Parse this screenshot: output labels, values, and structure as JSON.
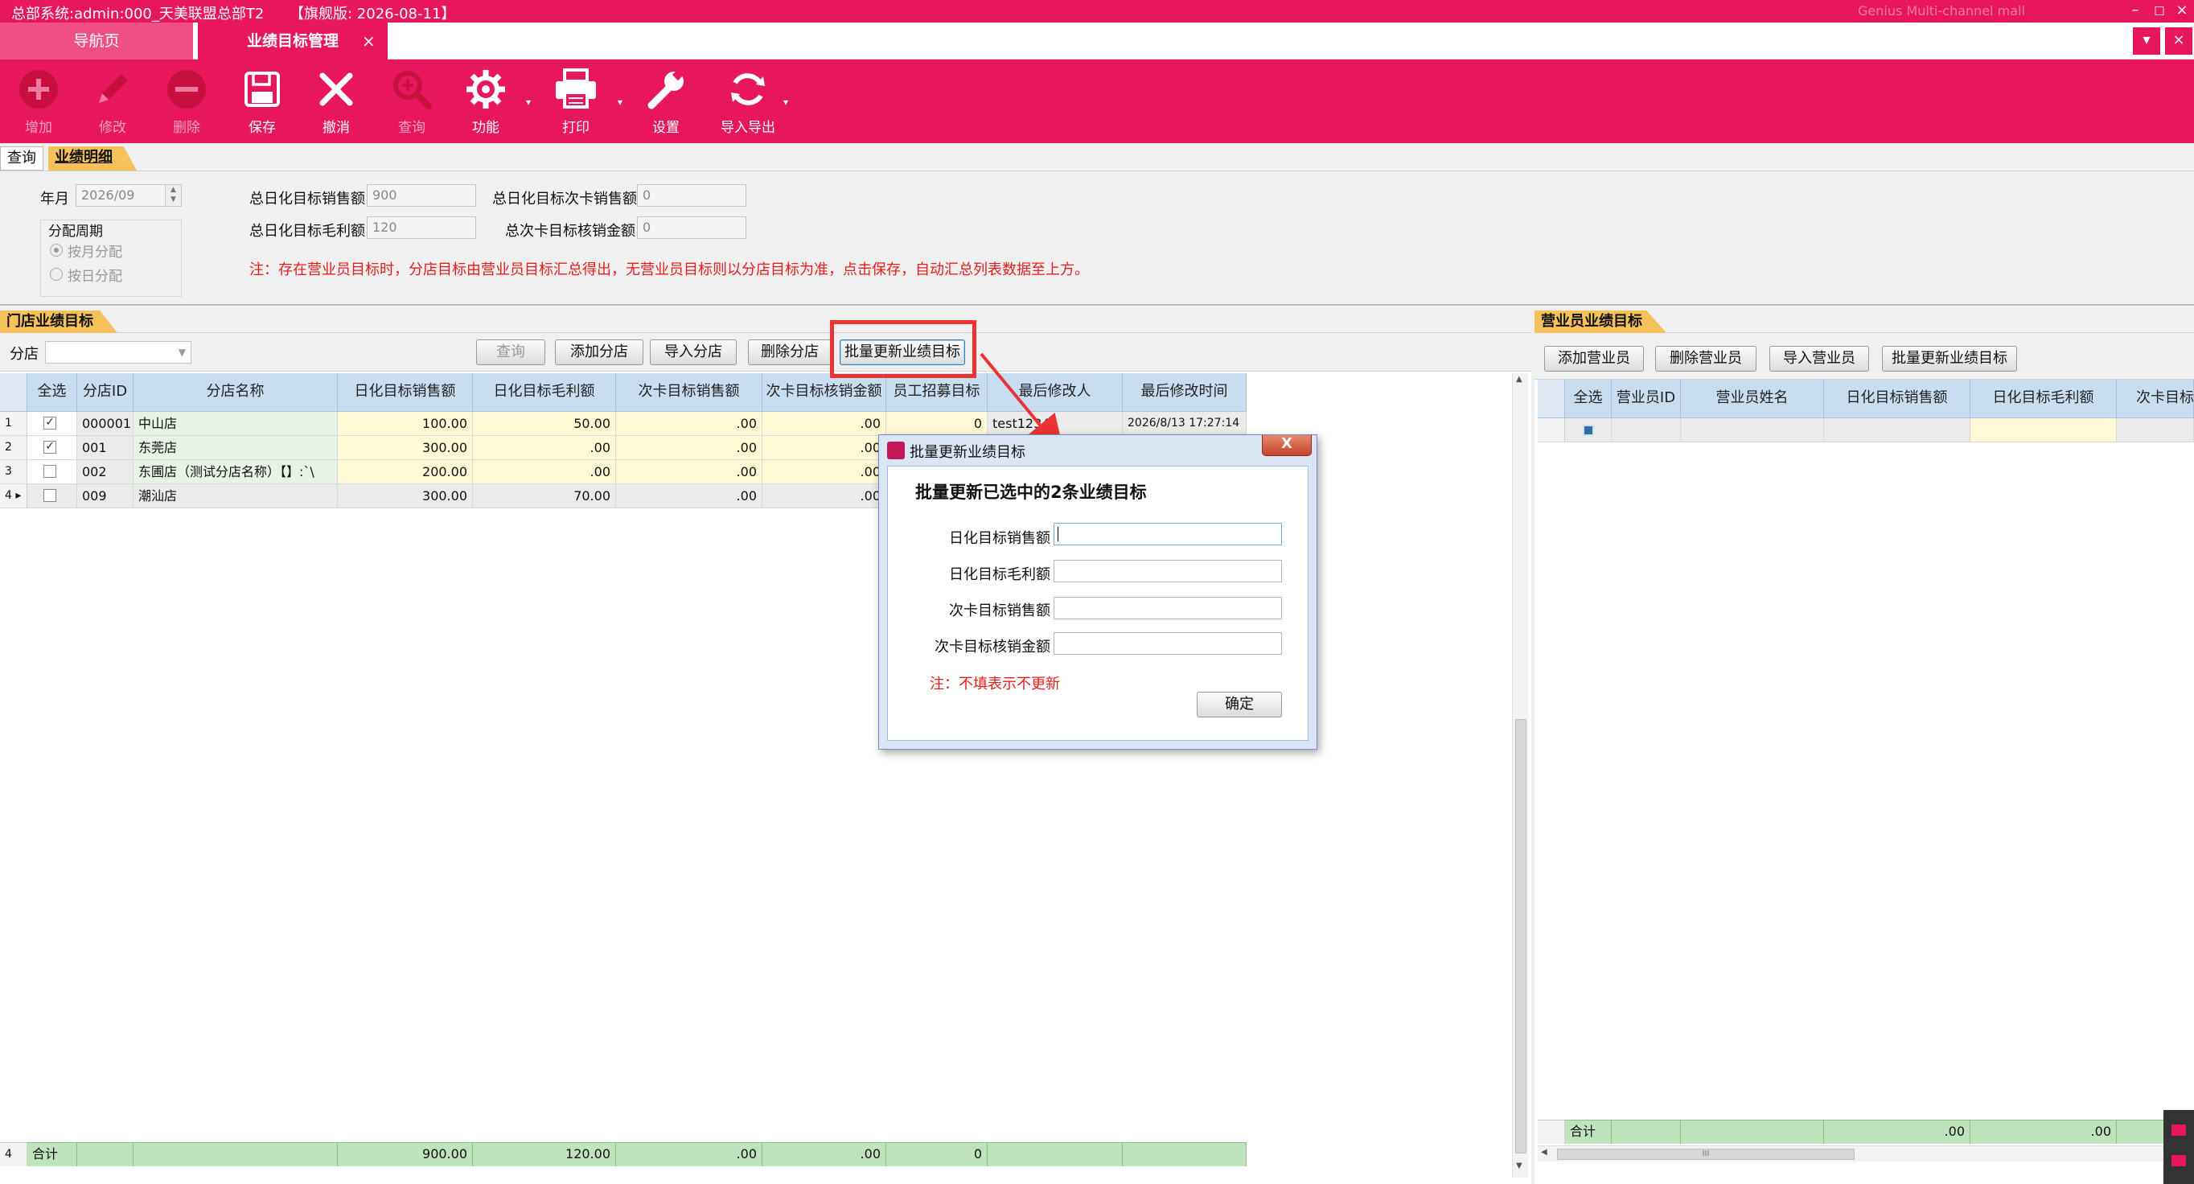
{
  "window": {
    "title": "总部系统:admin:000_天美联盟总部T2",
    "edition": "【旗舰版: 2026-08-11】",
    "faint_text": "Genius Multi-channel mall",
    "min_icon": "–",
    "max_icon": "□",
    "close_icon": "×"
  },
  "tabs": {
    "nav_label": "导航页",
    "perf_label": "业绩目标管理",
    "close_icon": "×",
    "dropdown_icon": "▾",
    "close_all_icon": "×"
  },
  "toolbar": {
    "add": "增加",
    "edit": "修改",
    "delete": "删除",
    "save": "保存",
    "cancel": "撤消",
    "query": "查询",
    "function": "功能",
    "print": "打印",
    "settings": "设置",
    "import_export": "导入导出",
    "caret": "▾"
  },
  "section": {
    "query_tab": "查询",
    "detail_tab": "业绩明细"
  },
  "form": {
    "year_month_label": "年月",
    "year_month_value": "2026/09",
    "period_label": "分配周期",
    "by_month": "按月分配",
    "by_day": "按日分配",
    "daily_sales_label": "总日化目标销售额",
    "daily_sales_value": "900",
    "daily_margin_label": "总日化目标毛利额",
    "daily_margin_value": "120",
    "card_sales_label": "总日化目标次卡销售额",
    "card_sales_value": "0",
    "card_writeoff_label": "总次卡目标核销金额",
    "card_writeoff_value": "0",
    "notice": "注：存在营业员目标时，分店目标由营业员目标汇总得出，无营业员目标则以分店目标为准，点击保存，自动汇总列表数据至上方。"
  },
  "store_panel": {
    "title": "门店业绩目标",
    "store_label": "分店",
    "query_btn": "查询",
    "add_btn": "添加分店",
    "import_btn": "导入分店",
    "delete_btn": "删除分店",
    "batch_btn": "批量更新业绩目标",
    "columns": [
      "全选",
      "分店ID",
      "分店名称",
      "日化目标销售额",
      "日化目标毛利额",
      "次卡目标销售额",
      "次卡目标核销金额",
      "员工招募目标",
      "最后修改人",
      "最后修改时间"
    ],
    "rows": [
      {
        "no": "1",
        "checked": true,
        "id": "000001",
        "name": "中山店",
        "sales": "100.00",
        "margin": "50.00",
        "card_sales": ".00",
        "card_wo": ".00",
        "recruit": "0",
        "modifier": "test12345",
        "time": "2026/8/13 17:27:14"
      },
      {
        "no": "2",
        "checked": true,
        "id": "001",
        "name": "东莞店",
        "sales": "300.00",
        "margin": ".00",
        "card_sales": ".00",
        "card_wo": ".00",
        "recruit": "",
        "modifier": "",
        "time": ""
      },
      {
        "no": "3",
        "checked": false,
        "id": "002",
        "name": "东圃店（测试分店名称）【】:`\\",
        "sales": "200.00",
        "margin": ".00",
        "card_sales": ".00",
        "card_wo": ".00",
        "recruit": "",
        "modifier": "",
        "time": ""
      },
      {
        "no": "4 ▸",
        "checked": false,
        "id": "009",
        "name": "潮汕店",
        "sales": "300.00",
        "margin": "70.00",
        "card_sales": ".00",
        "card_wo": ".00",
        "recruit": "",
        "modifier": "",
        "time": ""
      }
    ],
    "check_mark": "✓",
    "total": {
      "no": "4",
      "label": "合计",
      "sales": "900.00",
      "margin": "120.00",
      "card_sales": ".00",
      "card_wo": ".00",
      "recruit": "0"
    }
  },
  "sales_panel": {
    "title": "营业员业绩目标",
    "add_btn": "添加营业员",
    "delete_btn": "删除营业员",
    "import_btn": "导入营业员",
    "batch_btn": "批量更新业绩目标",
    "columns": [
      "全选",
      "营业员ID",
      "营业员姓名",
      "日化目标销售额",
      "日化目标毛利额",
      "次卡目标"
    ],
    "total": {
      "label": "合计",
      "sales": ".00",
      "margin": ".00"
    },
    "scroll_grip": "III"
  },
  "dialog": {
    "title": "批量更新业绩目标",
    "heading": "批量更新已选中的2条业绩目标",
    "field_sales": "日化目标销售额",
    "field_margin": "日化目标毛利额",
    "field_card_sales": "次卡目标销售额",
    "field_card_wo": "次卡目标核销金额",
    "note": "注：不填表示不更新",
    "ok_btn": "确定",
    "close_icon": "X"
  }
}
